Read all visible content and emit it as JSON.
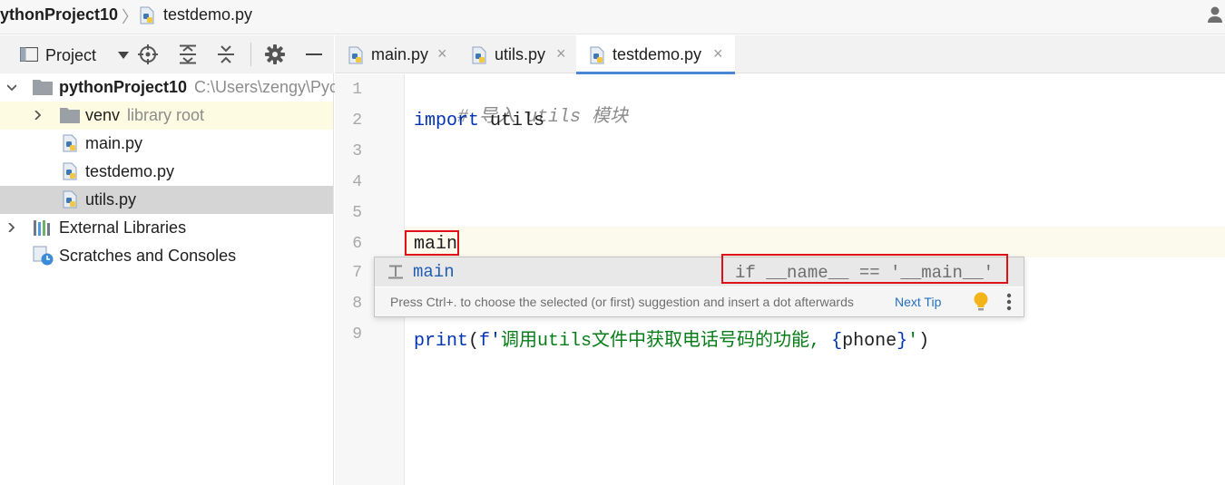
{
  "breadcrumb": {
    "project": "ythonProject10",
    "separator": "〉",
    "file": "testdemo.py"
  },
  "project_panel": {
    "title": "Project",
    "tree": [
      {
        "label": "pythonProject10",
        "hint": "C:\\Users\\zengy\\Pyc",
        "type": "folder",
        "expanded": true
      },
      {
        "label": "venv",
        "hint": "library root",
        "type": "folder",
        "expanded": false
      },
      {
        "label": "main.py",
        "type": "python-file"
      },
      {
        "label": "testdemo.py",
        "type": "python-file"
      },
      {
        "label": "utils.py",
        "type": "python-file",
        "selected": true
      },
      {
        "label": "External Libraries",
        "type": "libraries",
        "expanded": false
      },
      {
        "label": "Scratches and Consoles",
        "type": "scratches"
      }
    ]
  },
  "tabs": [
    {
      "label": "main.py",
      "close": "×",
      "active": false
    },
    {
      "label": "utils.py",
      "close": "×",
      "active": false
    },
    {
      "label": "testdemo.py",
      "close": "×",
      "active": true
    }
  ],
  "editor": {
    "line_numbers": [
      "1",
      "2",
      "3",
      "4",
      "5",
      "6",
      "7",
      "8",
      "9"
    ],
    "line1_comment": "# 导入 utils 模块",
    "line2_kw": "import",
    "line2_mod": " utils",
    "line6_typed": "main",
    "line9_fn": "print",
    "line9_open": "(",
    "line9_fprefix": "f'",
    "line9_text": "调用utils文件中获取电话号码的功能, ",
    "line9_brace_open": "{",
    "line9_var": "phone",
    "line9_brace_close": "}",
    "line9_quote": "'",
    "line9_close": ")"
  },
  "completion": {
    "name": "main",
    "description": "if __name__ == '__main__'",
    "help_text": "Press Ctrl+. to choose the selected (or first) suggestion and insert a dot afterwards",
    "next_tip": "Next Tip"
  },
  "colors": {
    "keyword": "#0033b3",
    "string": "#067d17",
    "comment": "#8c8c8c",
    "highlight_box": "#e0101a",
    "active_tab_underline": "#4a86d6",
    "selected_row": "#d5d5d5",
    "library_root_row": "#fdfce3"
  }
}
